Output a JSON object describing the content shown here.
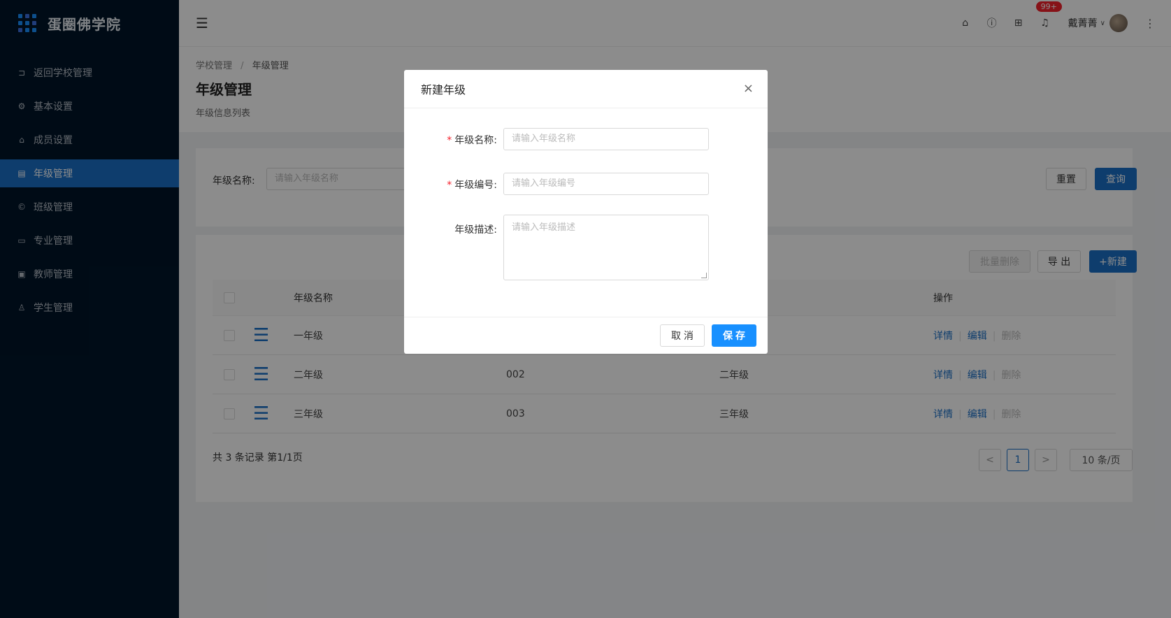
{
  "app": {
    "title": "蛋圈佛学院"
  },
  "sidebar": {
    "items": [
      {
        "label": "返回学校管理",
        "icon": "back-icon"
      },
      {
        "label": "基本设置",
        "icon": "gear-icon"
      },
      {
        "label": "成员设置",
        "icon": "home-icon"
      },
      {
        "label": "年级管理",
        "icon": "building-icon",
        "active": true
      },
      {
        "label": "班级管理",
        "icon": "copyright-icon"
      },
      {
        "label": "专业管理",
        "icon": "laptop-icon"
      },
      {
        "label": "教师管理",
        "icon": "id-card-icon"
      },
      {
        "label": "学生管理",
        "icon": "user-icon"
      }
    ]
  },
  "header": {
    "notification_count": "99+",
    "user_name": "戴菁菁"
  },
  "page": {
    "breadcrumb": [
      "学校管理",
      "/",
      "年级管理"
    ],
    "title": "年级管理",
    "subtitle": "年级信息列表"
  },
  "search": {
    "label": "年级名称:",
    "placeholder": "请输入年级名称",
    "reset_label": "重置",
    "query_label": "查询"
  },
  "toolbar": {
    "batch_delete_label": "批量删除",
    "export_label": "导 出",
    "new_label": "+新建"
  },
  "table": {
    "headers": {
      "name": "年级名称",
      "ops": "操作"
    },
    "rows": [
      {
        "name": "一年级",
        "code": "",
        "desc": ""
      },
      {
        "name": "二年级",
        "code": "002",
        "desc": "二年级"
      },
      {
        "name": "三年级",
        "code": "003",
        "desc": "三年级"
      }
    ],
    "ops": {
      "detail": "详情",
      "edit": "编辑",
      "delete": "删除"
    }
  },
  "pagination": {
    "total_text": "共 3 条记录 第1/1页",
    "prev": "<",
    "current": "1",
    "next": ">",
    "page_size": "10 条/页"
  },
  "modal": {
    "title": "新建年级",
    "close": "×",
    "fields": {
      "name": {
        "label": "年级名称:",
        "placeholder": "请输入年级名称",
        "required": "*"
      },
      "code": {
        "label": "年级编号:",
        "placeholder": "请输入年级编号",
        "required": "*"
      },
      "desc": {
        "label": "年级描述:",
        "placeholder": "请输入年级描述"
      }
    },
    "cancel_label": "取消",
    "save_label": "保存"
  }
}
